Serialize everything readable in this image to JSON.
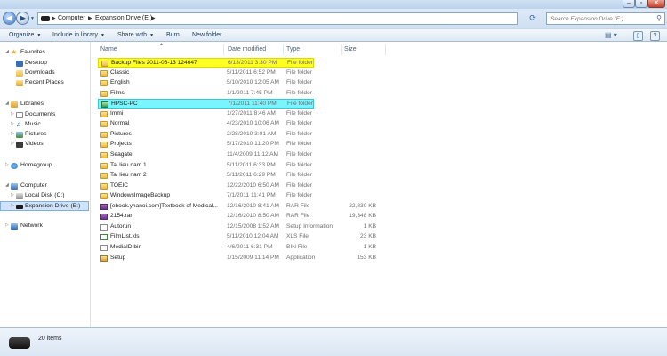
{
  "address": {
    "crumbs": [
      "Computer",
      "Expansion Drive (E:)"
    ],
    "search_placeholder": "Search Expansion Drive (E:)"
  },
  "toolbar": {
    "organize": "Organize",
    "include_in_library": "Include in library",
    "share_with": "Share with",
    "burn": "Burn",
    "new_folder": "New folder"
  },
  "nav": {
    "favorites": "Favorites",
    "desktop": "Desktop",
    "downloads": "Downloads",
    "recent_places": "Recent Places",
    "libraries": "Libraries",
    "documents": "Documents",
    "music": "Music",
    "pictures": "Pictures",
    "videos": "Videos",
    "homegroup": "Homegroup",
    "computer": "Computer",
    "local_disk": "Local Disk (C:)",
    "expansion_drive": "Expansion Drive (E:)",
    "network": "Network"
  },
  "columns": {
    "name": "Name",
    "date_modified": "Date modified",
    "type": "Type",
    "size": "Size"
  },
  "files": [
    {
      "name": "Backup Files 2011-06-13 124647",
      "date": "6/13/2011 3:30 PM",
      "type": "File folder",
      "size": "",
      "icon": "folder-icon",
      "highlight": "yellow"
    },
    {
      "name": "Classic",
      "date": "5/11/2011 6:52 PM",
      "type": "File folder",
      "size": "",
      "icon": "folder-icon",
      "highlight": ""
    },
    {
      "name": "English",
      "date": "5/10/2010 12:05 AM",
      "type": "File folder",
      "size": "",
      "icon": "folder-icon",
      "highlight": ""
    },
    {
      "name": "Films",
      "date": "1/1/2011 7:45 PM",
      "type": "File folder",
      "size": "",
      "icon": "folder-icon",
      "highlight": ""
    },
    {
      "name": "HPSC-PC",
      "date": "7/1/2011 11:40 PM",
      "type": "File folder",
      "size": "",
      "icon": "backup-folder-icon",
      "highlight": "cyan"
    },
    {
      "name": "Immi",
      "date": "1/27/2011 8:46 AM",
      "type": "File folder",
      "size": "",
      "icon": "folder-icon",
      "highlight": ""
    },
    {
      "name": "Normal",
      "date": "4/23/2010 10:06 AM",
      "type": "File folder",
      "size": "",
      "icon": "folder-icon",
      "highlight": ""
    },
    {
      "name": "Pictures",
      "date": "2/28/2010 3:01 AM",
      "type": "File folder",
      "size": "",
      "icon": "folder-icon",
      "highlight": ""
    },
    {
      "name": "Projects",
      "date": "5/17/2010 11:20 PM",
      "type": "File folder",
      "size": "",
      "icon": "folder-icon",
      "highlight": ""
    },
    {
      "name": "Seagate",
      "date": "11/4/2009 11:12 AM",
      "type": "File folder",
      "size": "",
      "icon": "folder-icon",
      "highlight": ""
    },
    {
      "name": "Tai lieu nam 1",
      "date": "5/11/2011 6:33 PM",
      "type": "File folder",
      "size": "",
      "icon": "folder-icon",
      "highlight": ""
    },
    {
      "name": "Tai lieu nam 2",
      "date": "5/11/2011 6:29 PM",
      "type": "File folder",
      "size": "",
      "icon": "folder-icon",
      "highlight": ""
    },
    {
      "name": "TOEIC",
      "date": "12/22/2010 6:50 AM",
      "type": "File folder",
      "size": "",
      "icon": "folder-icon",
      "highlight": ""
    },
    {
      "name": "WindowsImageBackup",
      "date": "7/1/2011 11:41 PM",
      "type": "File folder",
      "size": "",
      "icon": "folder-icon",
      "highlight": ""
    },
    {
      "name": "[ebook.yhanoi.com]Textbook of Medical...",
      "date": "12/16/2010 8:41 AM",
      "type": "RAR File",
      "size": "22,830 KB",
      "icon": "rar-icon",
      "highlight": ""
    },
    {
      "name": "2154.rar",
      "date": "12/16/2010 8:50 AM",
      "type": "RAR File",
      "size": "19,348 KB",
      "icon": "rar-icon",
      "highlight": ""
    },
    {
      "name": "Autorun",
      "date": "12/15/2008 1:52 AM",
      "type": "Setup Information",
      "size": "1 KB",
      "icon": "settings-file-icon",
      "highlight": ""
    },
    {
      "name": "FilmList.xls",
      "date": "5/11/2010 12:04 AM",
      "type": "XLS File",
      "size": "23 KB",
      "icon": "spreadsheet-icon",
      "highlight": ""
    },
    {
      "name": "MediaID.bin",
      "date": "4/6/2011 6:31 PM",
      "type": "BIN File",
      "size": "1 KB",
      "icon": "binary-file-icon",
      "highlight": ""
    },
    {
      "name": "Setup",
      "date": "1/15/2009 11:14 PM",
      "type": "Application",
      "size": "153 KB",
      "icon": "setup-icon",
      "highlight": ""
    }
  ],
  "status": {
    "item_count": "20 items"
  },
  "colors": {
    "highlight_yellow": "#ffff22",
    "highlight_cyan": "#7af5ff",
    "selection": "#cfe4fa"
  }
}
